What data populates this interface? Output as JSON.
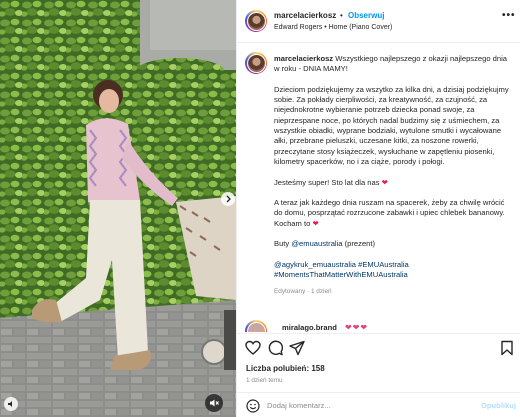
{
  "post": {
    "username": "marcelacierkosz",
    "follow_label": "Obserwuj",
    "separator": "•",
    "music": "Edward Rogers • Home (Piano Cover)",
    "more": "•••"
  },
  "caption": {
    "username": "marcelacierkosz",
    "line1": "Wszystkiego najlepszego z okazji najlepszego dnia w roku - DNIA MAMY!",
    "p2": "Dzieciom podziękujemy za wszytko za kilka dni, a dzisiaj podziękujmy sobie. Za pokłady cierpliwości, za kreatywność, za czujność, za niejednokrotne wybieranie potrzeb dziecka ponad swoje, za nieprzespane noce, po których nadal budzimy się z uśmiechem, za wszystkie obiadki, wyprane bodziaki, wytulone smutki i wycałowane ałki, przebrane pieluszki, uczesane kitki, za noszone rowerki, przeczytane stosy książeczek, wysłuchane w zapętleniu piosenki, kilometry spacerków, no i za ciąże, porody i połogi.",
    "p3": "Jesteśmy super! Sto lat dla nas",
    "p4": "A teraz jak każdego dnia ruszam na spacerek, żeby za chwilę wrócić do domu, posprzątać rozrzucone zabawki i upiec chlebek bananowy. Kocham to",
    "p5_prefix": "Buty",
    "p5_link": "@emuaustralia",
    "p5_suffix": "(prezent)",
    "tags_line1": "@agykruk_emuaustralia #EMUAustralia",
    "tags_line2": "#MomentsThatMatterWithEMUAustralia",
    "heart": "❤",
    "meta": "Edytowany · 1 dzień"
  },
  "next_comment": {
    "username": "miralago.brand",
    "emojis": "❤❤❤"
  },
  "engagement": {
    "likes": "Liczba polubień: 158",
    "time": "1 dzień temu"
  },
  "comment_box": {
    "placeholder": "Dodaj komentarz...",
    "publish_label": "Opublikuj"
  },
  "colors": {
    "accent": "#0095f6",
    "heart": "#ed1b4f",
    "link": "#00376b"
  }
}
